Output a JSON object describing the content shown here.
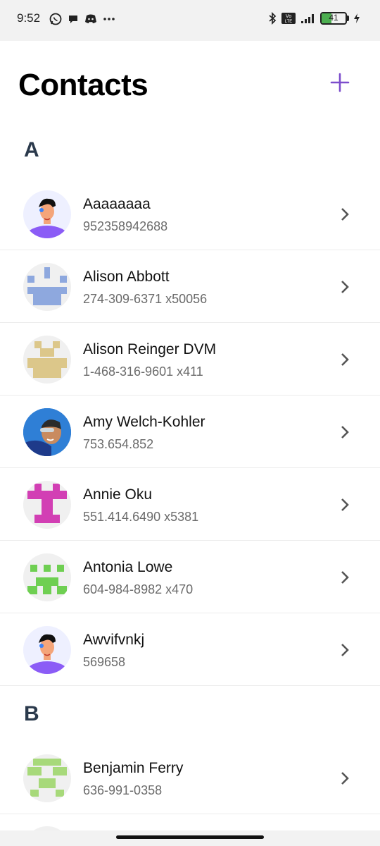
{
  "status_bar": {
    "time": "9:52",
    "left_icons": [
      "whatsapp-icon",
      "chat-bubble-icon",
      "discord-icon",
      "more-dots-icon"
    ],
    "right_icons": [
      "bluetooth-icon",
      "volte-icon",
      "signal-icon",
      "battery-icon",
      "charging-icon"
    ],
    "volte_label_top": "Vo",
    "volte_label_bottom": "LTE",
    "battery_level": "41",
    "battery_fraction": 0.41
  },
  "header": {
    "title": "Contacts",
    "add_icon": "plus-icon",
    "accent_color": "#7c4dcc"
  },
  "sections": [
    {
      "letter": "A",
      "contacts": [
        {
          "name": "Aaaaaaaa",
          "phone": "952358942688",
          "avatar": "cartoon-avatar"
        },
        {
          "name": "Alison Abbott",
          "phone": "274-309-6371 x50056",
          "avatar": "pixel-avatar-blue"
        },
        {
          "name": "Alison Reinger DVM",
          "phone": "1-468-316-9601 x411",
          "avatar": "pixel-avatar-gold"
        },
        {
          "name": "Amy Welch-Kohler",
          "phone": "753.654.852",
          "avatar": "photo-avatar"
        },
        {
          "name": "Annie Oku",
          "phone": "551.414.6490 x5381",
          "avatar": "pixel-avatar-magenta"
        },
        {
          "name": "Antonia Lowe",
          "phone": "604-984-8982 x470",
          "avatar": "pixel-avatar-green"
        },
        {
          "name": "Awvifvnkj",
          "phone": "569658",
          "avatar": "cartoon-avatar"
        }
      ]
    },
    {
      "letter": "B",
      "contacts": [
        {
          "name": "Benjamin Ferry",
          "phone": "636-991-0358",
          "avatar": "pixel-avatar-lightgreen"
        }
      ]
    }
  ]
}
